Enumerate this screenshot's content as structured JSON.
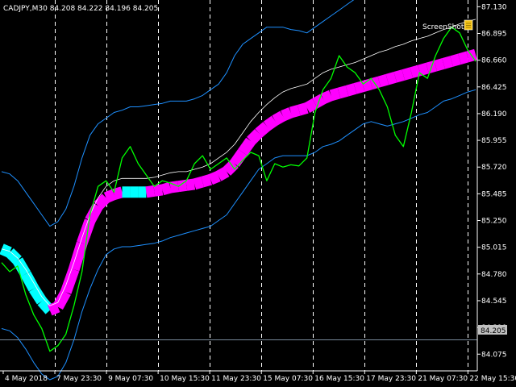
{
  "header": {
    "symbol_line": "CADJPY,M30  84.208 84.222 84.196 84.205",
    "screenshot_label": "ScreenShot"
  },
  "colors": {
    "background": "#000000",
    "price": "#00ff00",
    "upper_band": "#1e90ff",
    "lower_band": "#1e90ff",
    "middle_line": "#ffffff",
    "ribbon_bull": "#ff00ff",
    "ribbon_bear": "#00ffff",
    "grid": "#ffffff",
    "bid_line": "#778899",
    "axis_text": "#ffffff"
  },
  "chart_data": {
    "type": "line",
    "title": "CADJPY,M30",
    "ohlc_readout": {
      "open": 84.208,
      "high": 84.222,
      "low": 84.196,
      "close": 84.205
    },
    "current_price": 84.205,
    "ylim": [
      83.935,
      87.175
    ],
    "grid": "vertical dashed",
    "y_ticks": [
      "87.130",
      "86.895",
      "86.660",
      "86.425",
      "86.190",
      "85.955",
      "85.720",
      "85.485",
      "85.250",
      "85.015",
      "84.780",
      "84.545",
      "84.310",
      "84.075"
    ],
    "x_ticks": [
      "4 May 2018",
      "7 May 23:30",
      "9 May 07:30",
      "10 May 15:30",
      "11 May 23:30",
      "15 May 07:30",
      "16 May 15:30",
      "17 May 23:30",
      "21 May 07:30",
      "22 May 15:30"
    ],
    "bar_count": 60,
    "series": [
      {
        "name": "price",
        "values": [
          84.88,
          84.8,
          84.85,
          84.6,
          84.42,
          84.3,
          84.1,
          84.15,
          84.25,
          84.5,
          84.8,
          85.3,
          85.55,
          85.6,
          85.5,
          85.8,
          85.9,
          85.75,
          85.65,
          85.55,
          85.6,
          85.58,
          85.55,
          85.6,
          85.75,
          85.82,
          85.7,
          85.75,
          85.8,
          85.7,
          85.78,
          85.85,
          85.82,
          85.6,
          85.75,
          85.72,
          85.74,
          85.73,
          85.8,
          86.2,
          86.4,
          86.5,
          86.7,
          86.6,
          86.55,
          86.45,
          86.5,
          86.4,
          86.25,
          86.0,
          85.9,
          86.2,
          86.55,
          86.5,
          86.7,
          86.85,
          86.95,
          86.9,
          86.75,
          86.65
        ]
      },
      {
        "name": "upper band",
        "values": [
          85.68,
          85.66,
          85.6,
          85.5,
          85.4,
          85.3,
          85.2,
          85.24,
          85.35,
          85.55,
          85.8,
          86.0,
          86.1,
          86.15,
          86.2,
          86.22,
          86.25,
          86.25,
          86.26,
          86.27,
          86.28,
          86.3,
          86.3,
          86.3,
          86.32,
          86.35,
          86.4,
          86.45,
          86.55,
          86.7,
          86.8,
          86.85,
          86.9,
          86.95,
          86.95,
          86.95,
          86.93,
          86.92,
          86.9,
          86.95,
          87.0,
          87.05,
          87.1,
          87.15,
          87.2,
          87.25,
          87.25,
          87.22,
          87.2,
          87.22,
          87.25,
          87.3,
          87.35,
          87.4,
          87.45,
          87.5,
          87.5,
          87.55,
          87.55,
          87.6
        ]
      },
      {
        "name": "middle line",
        "values": [
          85.0,
          84.98,
          84.92,
          84.82,
          84.7,
          84.58,
          84.5,
          84.53,
          84.68,
          84.88,
          85.1,
          85.3,
          85.45,
          85.55,
          85.6,
          85.62,
          85.62,
          85.62,
          85.62,
          85.63,
          85.65,
          85.67,
          85.68,
          85.68,
          85.7,
          85.72,
          85.75,
          85.8,
          85.85,
          85.92,
          86.02,
          86.12,
          86.2,
          86.27,
          86.33,
          86.38,
          86.41,
          86.43,
          86.45,
          86.5,
          86.55,
          86.58,
          86.6,
          86.62,
          86.64,
          86.67,
          86.7,
          86.73,
          86.75,
          86.78,
          86.8,
          86.83,
          86.85,
          86.87,
          86.9,
          86.93,
          86.95,
          86.98,
          87.0,
          87.02
        ]
      },
      {
        "name": "lower band",
        "values": [
          84.3,
          84.28,
          84.22,
          84.12,
          84.0,
          83.9,
          83.85,
          83.88,
          84.0,
          84.2,
          84.45,
          84.65,
          84.82,
          84.95,
          85.0,
          85.02,
          85.02,
          85.03,
          85.04,
          85.05,
          85.07,
          85.1,
          85.12,
          85.14,
          85.16,
          85.18,
          85.2,
          85.25,
          85.3,
          85.4,
          85.5,
          85.6,
          85.7,
          85.75,
          85.8,
          85.82,
          85.82,
          85.82,
          85.82,
          85.85,
          85.9,
          85.92,
          85.95,
          86.0,
          86.05,
          86.1,
          86.12,
          86.1,
          86.08,
          86.1,
          86.12,
          86.15,
          86.18,
          86.2,
          86.25,
          86.3,
          86.32,
          86.35,
          86.38,
          86.4
        ]
      },
      {
        "name": "ribbon",
        "values": [
          85.0,
          84.97,
          84.9,
          84.78,
          84.65,
          84.54,
          84.46,
          84.49,
          84.62,
          84.82,
          85.05,
          85.25,
          85.38,
          85.45,
          85.48,
          85.5,
          85.5,
          85.5,
          85.5,
          85.51,
          85.52,
          85.54,
          85.55,
          85.56,
          85.57,
          85.59,
          85.61,
          85.64,
          85.68,
          85.75,
          85.85,
          85.95,
          86.02,
          86.08,
          86.13,
          86.17,
          86.2,
          86.22,
          86.24,
          86.28,
          86.32,
          86.35,
          86.37,
          86.39,
          86.41,
          86.43,
          86.45,
          86.47,
          86.49,
          86.51,
          86.53,
          86.55,
          86.57,
          86.59,
          86.61,
          86.63,
          86.65,
          86.67,
          86.69,
          86.71
        ]
      }
    ]
  }
}
